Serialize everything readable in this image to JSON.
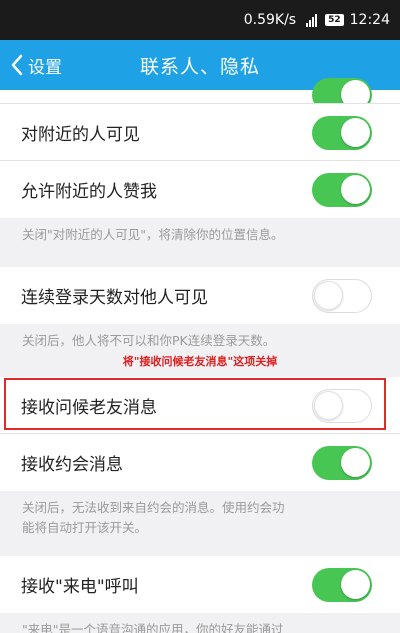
{
  "statusbar": {
    "speed": "0.59K/s",
    "battery": "52",
    "time": "12:24"
  },
  "navbar": {
    "back_label": "设置",
    "title": "联系人、隐私"
  },
  "settings": [
    {
      "label": "对附近的人可见",
      "enabled": true
    },
    {
      "label": "允许附近的人赞我",
      "enabled": true
    },
    {
      "label": "连续登录天数对他人可见",
      "enabled": false
    },
    {
      "label": "接收问候老友消息",
      "enabled": false
    },
    {
      "label": "接收约会消息",
      "enabled": true
    },
    {
      "label": "接收\"来电\"呼叫",
      "enabled": true
    }
  ],
  "notes": {
    "nearby": "关闭\"对附近的人可见\"，将清除你的位置信息。",
    "login_days": "关闭后，他人将不可以和你PK连续登录天数。",
    "dating_line1": "关闭后，无法收到来自约会的消息。使用约会功",
    "dating_line2": "能将自动打开该开关。",
    "call_partial": "\"来电\"是一个语音沟通的应用，你的好友能通过"
  },
  "annotation": "将\"接收问候老友消息\"这项关掉",
  "colors": {
    "navbar": "#1fa1e6",
    "toggle_on": "#47c653",
    "highlight": "#e02a2a"
  }
}
